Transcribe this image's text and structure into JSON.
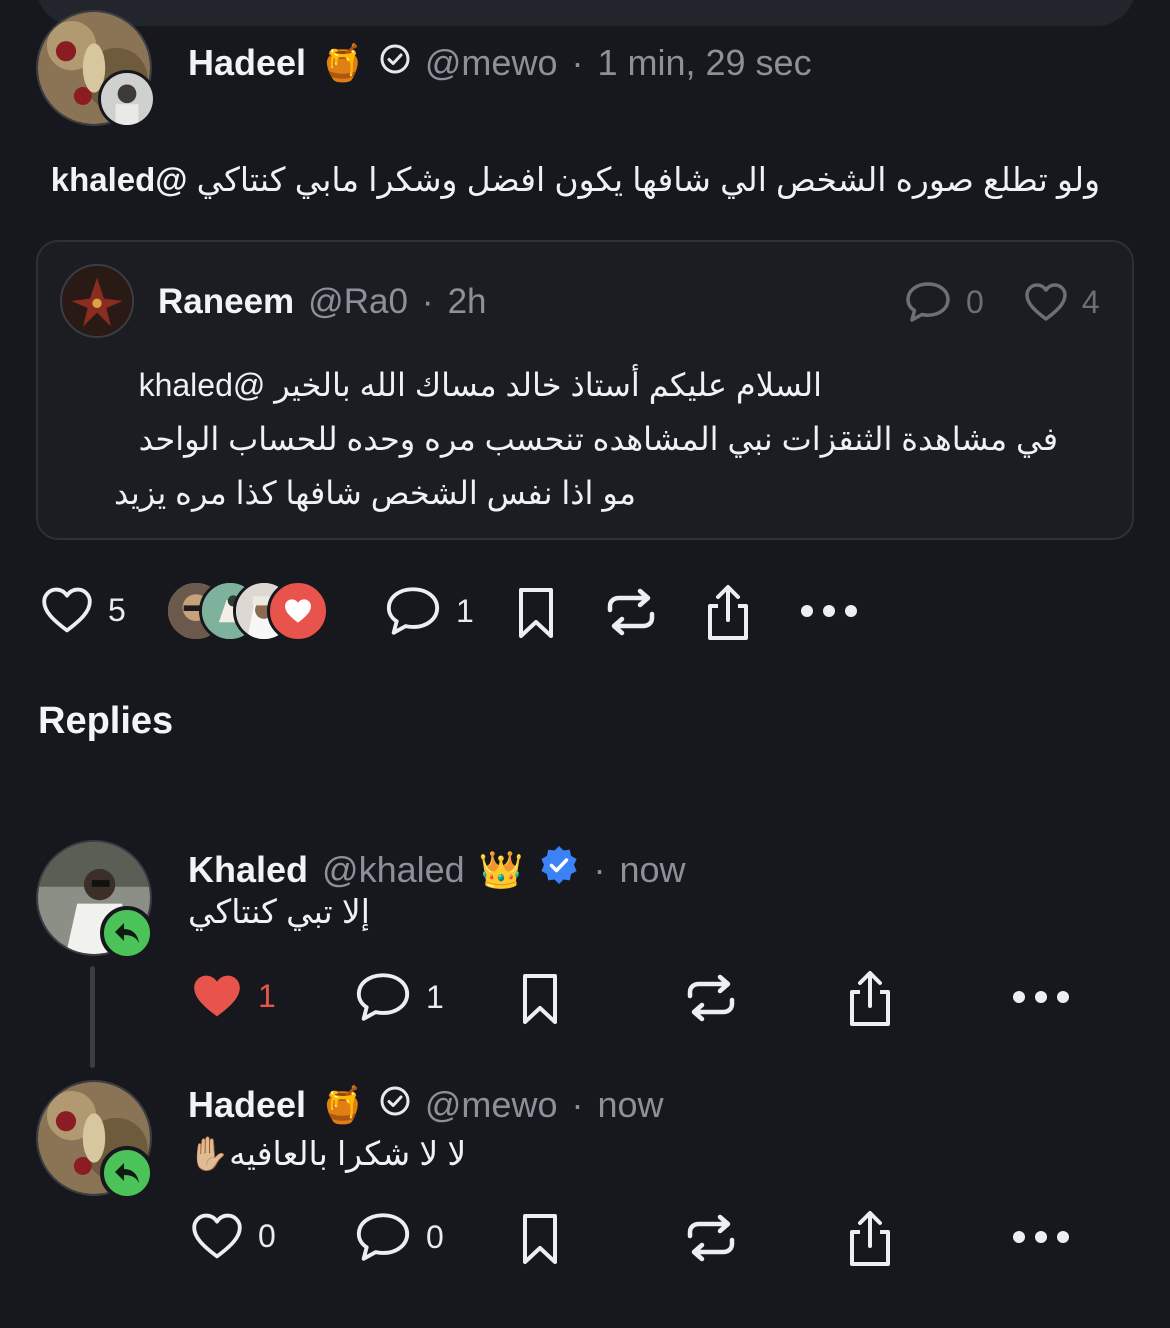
{
  "post": {
    "author_name": "Hadeel",
    "author_emoji": "🍯",
    "handle": "@mewo",
    "separator": "·",
    "time": "1 min, 29 sec",
    "text_mention": "@khaled",
    "text_body": "ولو تطلع صوره الشخص الي شافها يكون افضل وشكرا مابي كنتاكي",
    "quote": {
      "author_name": "Raneem",
      "handle": "@Ra0",
      "separator": "·",
      "time": "2h",
      "comments": "0",
      "likes": "4",
      "line1_body": "السلام عليكم أستاذ خالد مساك الله بالخير",
      "line1_mention": "@khaled",
      "line2": "في مشاهدة الثنقزات نبي المشاهده تنحسب مره وحده للحساب الواحد",
      "line3": "مو اذا نفس الشخص شافها كذا مره يزيد"
    },
    "likes": "5",
    "comments": "1"
  },
  "replies_title": "Replies",
  "replies": [
    {
      "author_name": "Khaled",
      "handle": "@khaled",
      "crown": "👑",
      "separator": "·",
      "time": "now",
      "text": "إلا تبي كنتاكي",
      "likes": "1",
      "comments": "1"
    },
    {
      "author_name": "Hadeel",
      "author_emoji": "🍯",
      "handle": "@mewo",
      "separator": "·",
      "time": "now",
      "text": "لا لا شكرا بالعافيه",
      "text_emoji": "✋🏼",
      "likes": "0",
      "comments": "0"
    }
  ],
  "colors": {
    "background": "#16181d",
    "like_red": "#e8544b",
    "reply_green": "#4cc359",
    "verified_blue": "#3b82f6",
    "muted": "#8d9099"
  },
  "icons": [
    "heart-icon",
    "comment-icon",
    "bookmark-icon",
    "repost-icon",
    "share-icon",
    "more-icon",
    "verified-icon",
    "reply-arrow-icon"
  ]
}
